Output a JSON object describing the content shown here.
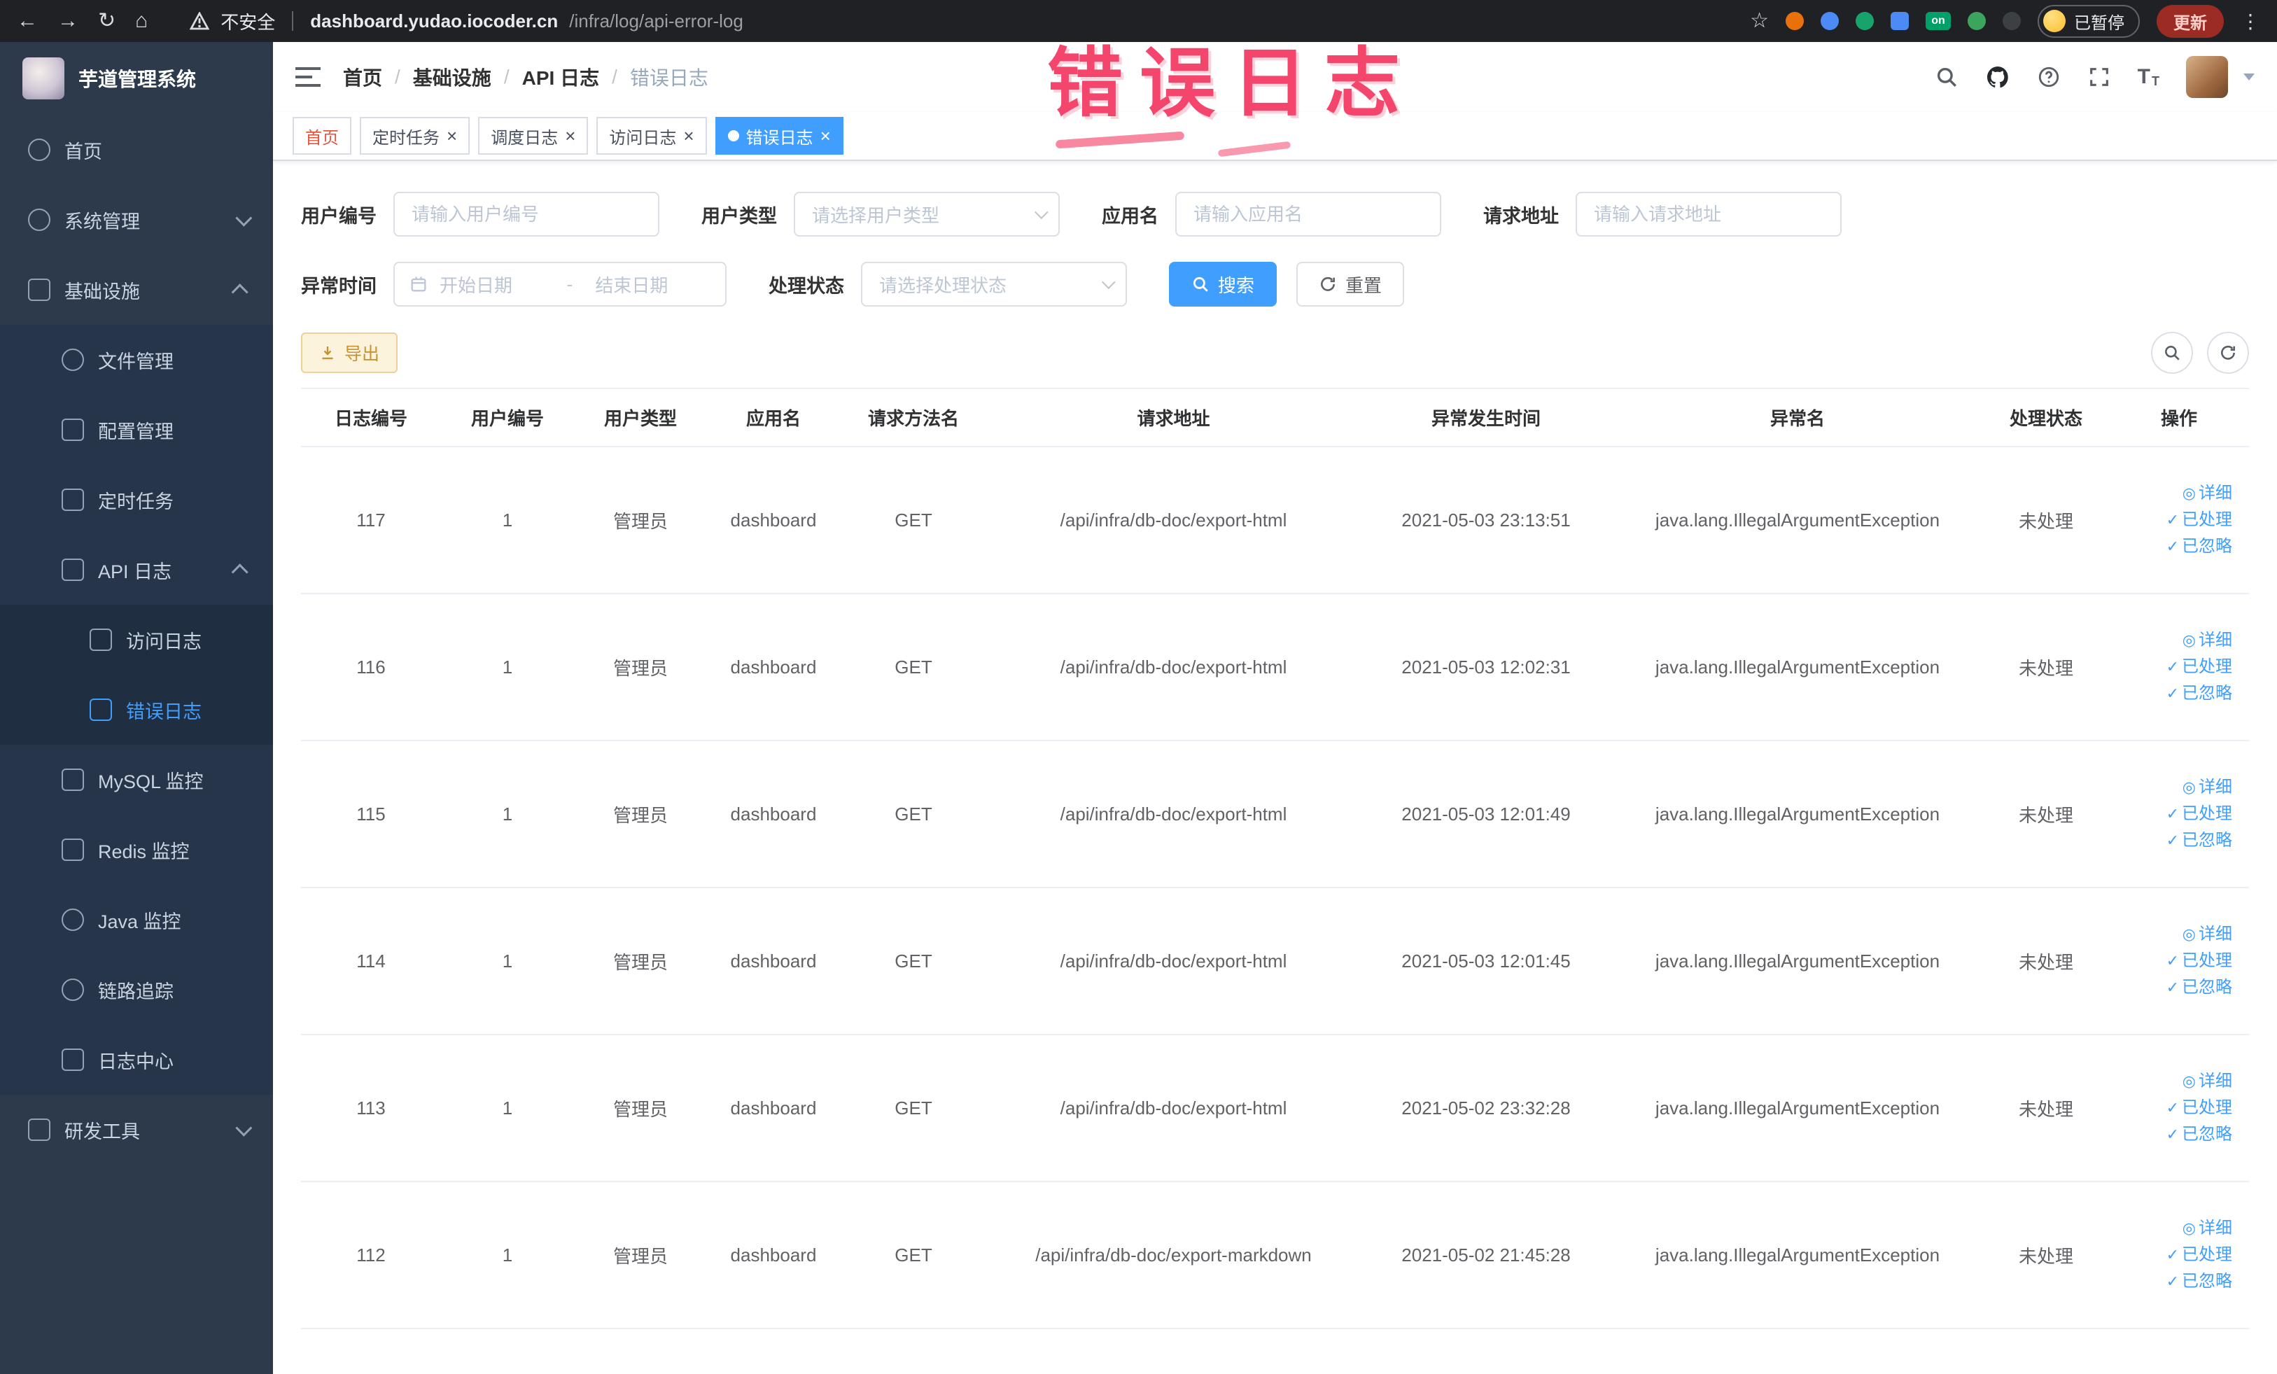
{
  "theme": {
    "primary": "#409eff",
    "sidebar_bg": "#2d3a4b",
    "warning": "#e6a23c",
    "annotation_color": "#f4466d"
  },
  "browser": {
    "security_label": "不安全",
    "url_host": "dashboard.yudao.iocoder.cn",
    "url_path": "/infra/log/api-error-log",
    "paused_label": "已暂停",
    "update_label": "更新",
    "extension_on_label": "on"
  },
  "annotation": {
    "text": "错误日志"
  },
  "icons": {
    "back": "←",
    "forward": "→",
    "reload": "↻",
    "home": "⌂",
    "star": "☆",
    "kebab": "⋮",
    "close": "×",
    "view": "◎",
    "check": "✓"
  },
  "sidebar": {
    "title": "芋道管理系统",
    "items": [
      {
        "label": "首页"
      },
      {
        "label": "系统管理"
      },
      {
        "label": "基础设施"
      },
      {
        "label": "文件管理"
      },
      {
        "label": "配置管理"
      },
      {
        "label": "定时任务"
      },
      {
        "label": "API 日志"
      },
      {
        "label": "访问日志"
      },
      {
        "label": "错误日志"
      },
      {
        "label": "MySQL 监控"
      },
      {
        "label": "Redis 监控"
      },
      {
        "label": "Java 监控"
      },
      {
        "label": "链路追踪"
      },
      {
        "label": "日志中心"
      },
      {
        "label": "研发工具"
      }
    ]
  },
  "breadcrumb": {
    "separator": "/",
    "items": [
      "首页",
      "基础设施",
      "API 日志",
      "错误日志"
    ]
  },
  "tabs": [
    {
      "label": "首页"
    },
    {
      "label": "定时任务"
    },
    {
      "label": "调度日志"
    },
    {
      "label": "访问日志"
    },
    {
      "label": "错误日志"
    }
  ],
  "filters": {
    "user_id": {
      "label": "用户编号",
      "placeholder": "请输入用户编号"
    },
    "user_type": {
      "label": "用户类型",
      "placeholder": "请选择用户类型"
    },
    "app_name": {
      "label": "应用名",
      "placeholder": "请输入应用名"
    },
    "request_url": {
      "label": "请求地址",
      "placeholder": "请输入请求地址"
    },
    "time": {
      "label": "异常时间",
      "start_placeholder": "开始日期",
      "separator": "-",
      "end_placeholder": "结束日期"
    },
    "status": {
      "label": "处理状态",
      "placeholder": "请选择处理状态"
    },
    "search_label": "搜索",
    "reset_label": "重置"
  },
  "toolbar": {
    "export_label": "导出"
  },
  "table": {
    "columns": [
      "日志编号",
      "用户编号",
      "用户类型",
      "应用名",
      "请求方法名",
      "请求地址",
      "异常发生时间",
      "异常名",
      "处理状态",
      "操作"
    ],
    "action_labels": [
      "详细",
      "已处理",
      "已忽略"
    ],
    "rows": [
      {
        "log_id": "117",
        "user_id": "1",
        "user_type": "管理员",
        "app_name": "dashboard",
        "method": "GET",
        "url": "/api/infra/db-doc/export-html",
        "time": "2021-05-03 23:13:51",
        "exception": "java.lang.IllegalArgumentException",
        "status": "未处理"
      },
      {
        "log_id": "116",
        "user_id": "1",
        "user_type": "管理员",
        "app_name": "dashboard",
        "method": "GET",
        "url": "/api/infra/db-doc/export-html",
        "time": "2021-05-03 12:02:31",
        "exception": "java.lang.IllegalArgumentException",
        "status": "未处理"
      },
      {
        "log_id": "115",
        "user_id": "1",
        "user_type": "管理员",
        "app_name": "dashboard",
        "method": "GET",
        "url": "/api/infra/db-doc/export-html",
        "time": "2021-05-03 12:01:49",
        "exception": "java.lang.IllegalArgumentException",
        "status": "未处理"
      },
      {
        "log_id": "114",
        "user_id": "1",
        "user_type": "管理员",
        "app_name": "dashboard",
        "method": "GET",
        "url": "/api/infra/db-doc/export-html",
        "time": "2021-05-03 12:01:45",
        "exception": "java.lang.IllegalArgumentException",
        "status": "未处理"
      },
      {
        "log_id": "113",
        "user_id": "1",
        "user_type": "管理员",
        "app_name": "dashboard",
        "method": "GET",
        "url": "/api/infra/db-doc/export-html",
        "time": "2021-05-02 23:32:28",
        "exception": "java.lang.IllegalArgumentException",
        "status": "未处理"
      },
      {
        "log_id": "112",
        "user_id": "1",
        "user_type": "管理员",
        "app_name": "dashboard",
        "method": "GET",
        "url": "/api/infra/db-doc/export-markdown",
        "time": "2021-05-02 21:45:28",
        "exception": "java.lang.IllegalArgumentException",
        "status": "未处理"
      }
    ]
  }
}
